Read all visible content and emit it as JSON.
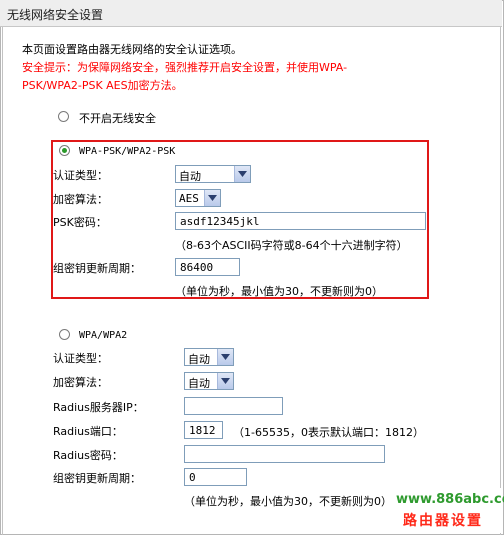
{
  "page": {
    "title": "无线网络安全设置",
    "intro": "本页面设置路由器无线网络的安全认证选项。",
    "hint_line1": "安全提示：为保障网络安全，强烈推荐开启安全设置，并使用WPA-",
    "hint_line2": "PSK/WPA2-PSK AES加密方法。"
  },
  "no_security": {
    "label": "不开启无线安全",
    "selected": false
  },
  "wpa_psk": {
    "label": "WPA-PSK/WPA2-PSK",
    "selected": true,
    "auth_type_label": "认证类型：",
    "auth_type_value": "自动",
    "encryption_label": "加密算法：",
    "encryption_value": "AES",
    "psk_label": "PSK密码：",
    "psk_value": "asdf12345jkl",
    "psk_hint": "（8-63个ASCII码字符或8-64个十六进制字符）",
    "group_key_label": "组密钥更新周期：",
    "group_key_value": "86400",
    "group_key_hint": "（单位为秒，最小值为30，不更新则为0）"
  },
  "wpa": {
    "label": "WPA/WPA2",
    "selected": false,
    "auth_type_label": "认证类型：",
    "auth_type_value": "自动",
    "encryption_label": "加密算法：",
    "encryption_value": "自动",
    "radius_ip_label": "Radius服务器IP：",
    "radius_ip_value": "",
    "radius_port_label": "Radius端口：",
    "radius_port_value": "1812",
    "radius_port_hint": "（1-65535，0表示默认端口：1812）",
    "radius_password_label": "Radius密码：",
    "radius_password_value": "",
    "group_key_label": "组密钥更新周期：",
    "group_key_value": "0",
    "group_key_hint": "（单位为秒，最小值为30，不更新则为0）"
  },
  "watermark": {
    "url": "www.886abc.com",
    "text": "路由器设置"
  },
  "colors": {
    "hint_red": "#ff0000",
    "highlight_box": "#e01818",
    "radio_selected": "#2a9a2a",
    "watermark_green": "#2e9a2e",
    "watermark_red": "#ff2a1a"
  }
}
